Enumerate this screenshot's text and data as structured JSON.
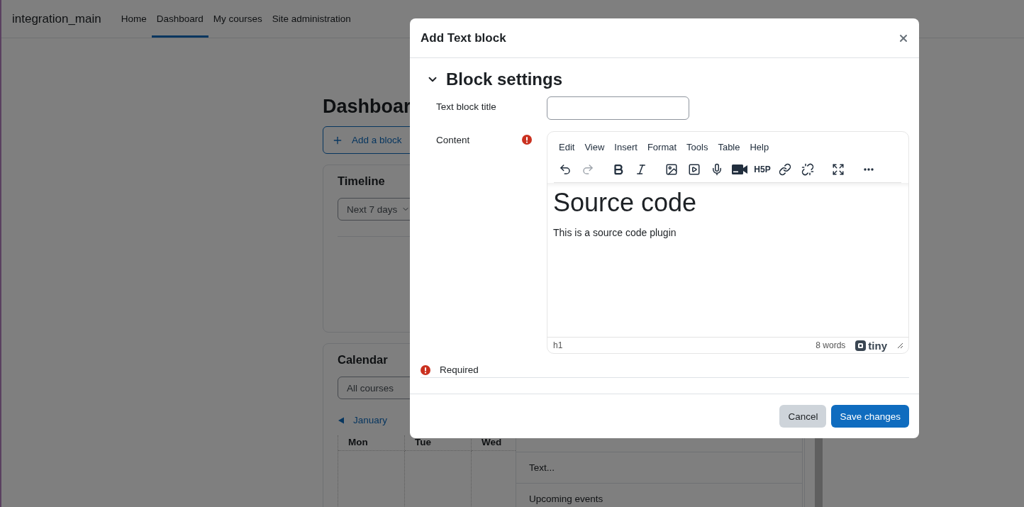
{
  "navbar": {
    "brand": "integration_main",
    "items": [
      {
        "label": "Home",
        "selected": false
      },
      {
        "label": "Dashboard",
        "selected": true
      },
      {
        "label": "My courses",
        "selected": false
      },
      {
        "label": "Site administration",
        "selected": false
      }
    ]
  },
  "page": {
    "heading": "Dashboar",
    "add_block_button": "Add a block",
    "timeline": {
      "title": "Timeline",
      "filter": "Next 7 days"
    },
    "calendar": {
      "title": "Calendar",
      "filter": "All courses",
      "month_link": "January",
      "weekdays": [
        "Mon",
        "Tue",
        "Wed"
      ]
    },
    "block_menu": {
      "items": [
        "Text...",
        "Upcoming events"
      ]
    }
  },
  "modal": {
    "title": "Add Text block",
    "section": {
      "title": "Block settings",
      "expanded": true
    },
    "fields": [
      {
        "kind": "text",
        "label": "Text block title",
        "required": false
      },
      {
        "kind": "editor",
        "label": "Content",
        "required": true
      }
    ],
    "editor": {
      "menu": [
        "Edit",
        "View",
        "Insert",
        "Format",
        "Tools",
        "Table",
        "Help"
      ],
      "toolbar": [
        {
          "items": [
            {
              "kind": "undo",
              "disabled": false
            },
            {
              "kind": "redo",
              "disabled": true
            }
          ]
        },
        {
          "items": [
            {
              "kind": "bold",
              "disabled": false
            },
            {
              "kind": "italic",
              "disabled": false
            }
          ]
        },
        {
          "items": [
            {
              "kind": "image",
              "disabled": false
            },
            {
              "kind": "media",
              "disabled": false
            },
            {
              "kind": "mic",
              "disabled": false
            },
            {
              "kind": "video",
              "disabled": false
            },
            {
              "kind": "h5p",
              "label": "H5P",
              "disabled": false
            },
            {
              "kind": "link",
              "disabled": false
            },
            {
              "kind": "unlink",
              "disabled": false
            }
          ]
        },
        {
          "items": [
            {
              "kind": "fullscreen",
              "disabled": false
            }
          ]
        },
        {
          "items": [
            {
              "kind": "more",
              "disabled": false
            }
          ]
        }
      ],
      "content": {
        "heading": "Source code",
        "paragraph": "This is a source code plugin"
      },
      "status": {
        "path": "h1",
        "word_count": "8 words",
        "brand": "tiny"
      }
    },
    "required_note": "Required",
    "buttons": [
      {
        "kind": "secondary",
        "label": "Cancel"
      },
      {
        "kind": "primary",
        "label": "Save changes"
      }
    ]
  }
}
